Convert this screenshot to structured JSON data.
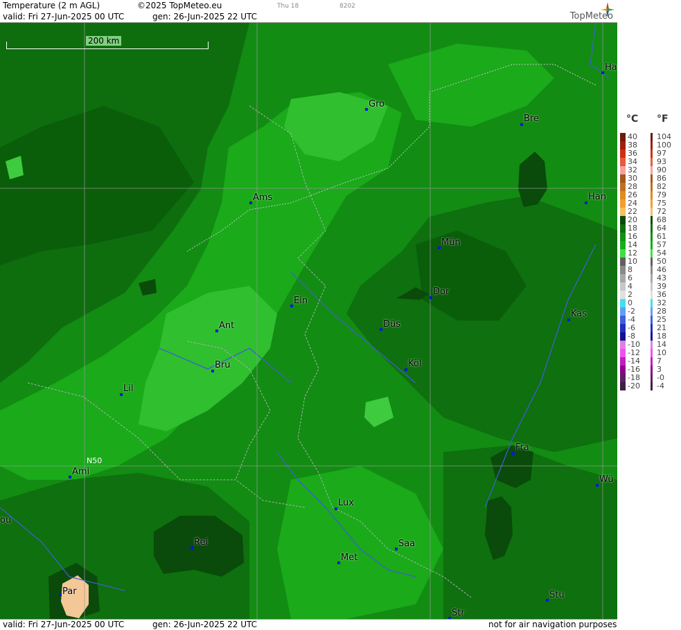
{
  "header": {
    "product": "Temperature (2 m AGL)",
    "copyright": "©2025 TopMeteo.eu",
    "valid": "valid:  Fri  27-Jun-2025  00 UTC",
    "generated": "gen:  26-Jun-2025  22 UTC",
    "day": "Thu 18",
    "code": "8202",
    "brand": "TopMeteo"
  },
  "footer": {
    "valid": "valid:  Fri  27-Jun-2025  00 UTC",
    "generated": "gen:  26-Jun-2025  22 UTC",
    "disclaimer": "not for air navigation purposes"
  },
  "scale": {
    "label": "200 km"
  },
  "grid_label": "N50",
  "cities": [
    {
      "name": "Gro"
    },
    {
      "name": "Bre"
    },
    {
      "name": "Ha"
    },
    {
      "name": "Ams"
    },
    {
      "name": "Han"
    },
    {
      "name": "Mün"
    },
    {
      "name": "Ein"
    },
    {
      "name": "Dor"
    },
    {
      "name": "Ant"
    },
    {
      "name": "Düs"
    },
    {
      "name": "Kas"
    },
    {
      "name": "Bru"
    },
    {
      "name": "Köl"
    },
    {
      "name": "Lil"
    },
    {
      "name": "Ami"
    },
    {
      "name": "Fra"
    },
    {
      "name": "Wü"
    },
    {
      "name": "ou"
    },
    {
      "name": "Lux"
    },
    {
      "name": "Rei"
    },
    {
      "name": "Saa"
    },
    {
      "name": "Met"
    },
    {
      "name": "Par"
    },
    {
      "name": "Stu"
    },
    {
      "name": "Str"
    }
  ],
  "legend": {
    "celsius_header": "°C",
    "fahrenheit_header": "°F",
    "celsius": [
      "40",
      "38",
      "36",
      "34",
      "32",
      "30",
      "28",
      "26",
      "24",
      "22",
      "20",
      "18",
      "16",
      "14",
      "12",
      "10",
      "8",
      "6",
      "4",
      "2",
      "0",
      "-2",
      "-4",
      "-6",
      "-8",
      "-10",
      "-12",
      "-14",
      "-16",
      "-18",
      "-20"
    ],
    "fahrenheit": [
      "104",
      "100",
      "97",
      "93",
      "90",
      "86",
      "82",
      "79",
      "75",
      "72",
      "68",
      "64",
      "61",
      "57",
      "54",
      "50",
      "46",
      "43",
      "39",
      "36",
      "32",
      "28",
      "25",
      "21",
      "18",
      "14",
      "10",
      "7",
      "3",
      "-0",
      "-4"
    ],
    "colors": [
      "#6e1a0a",
      "#a02010",
      "#d03010",
      "#e85a3a",
      "#f4a0a0",
      "#a05a1a",
      "#c07020",
      "#e08a20",
      "#f0a030",
      "#f8c060",
      "#0a4a0a",
      "#0e700e",
      "#129012",
      "#18b018",
      "#40e040",
      "#606060",
      "#8a8a8a",
      "#a8a8a8",
      "#c8c8c8",
      "#e0e0e0",
      "#40e0f0",
      "#60a0f0",
      "#4060e0",
      "#2030c0",
      "#101090",
      "#e080e0",
      "#f050f0",
      "#c020c0",
      "#900090",
      "#602060",
      "#402040"
    ]
  },
  "colors": {
    "t20_plus": "#0a4a0a",
    "t18": "#0e6e0e",
    "t16": "#128c12",
    "t14": "#1aaa1a",
    "t12": "#3ecc3e",
    "t30": "#f4c896",
    "city_dot": "#0a18d6",
    "river": "#3e5fd0",
    "border": "#b0b0b0"
  }
}
